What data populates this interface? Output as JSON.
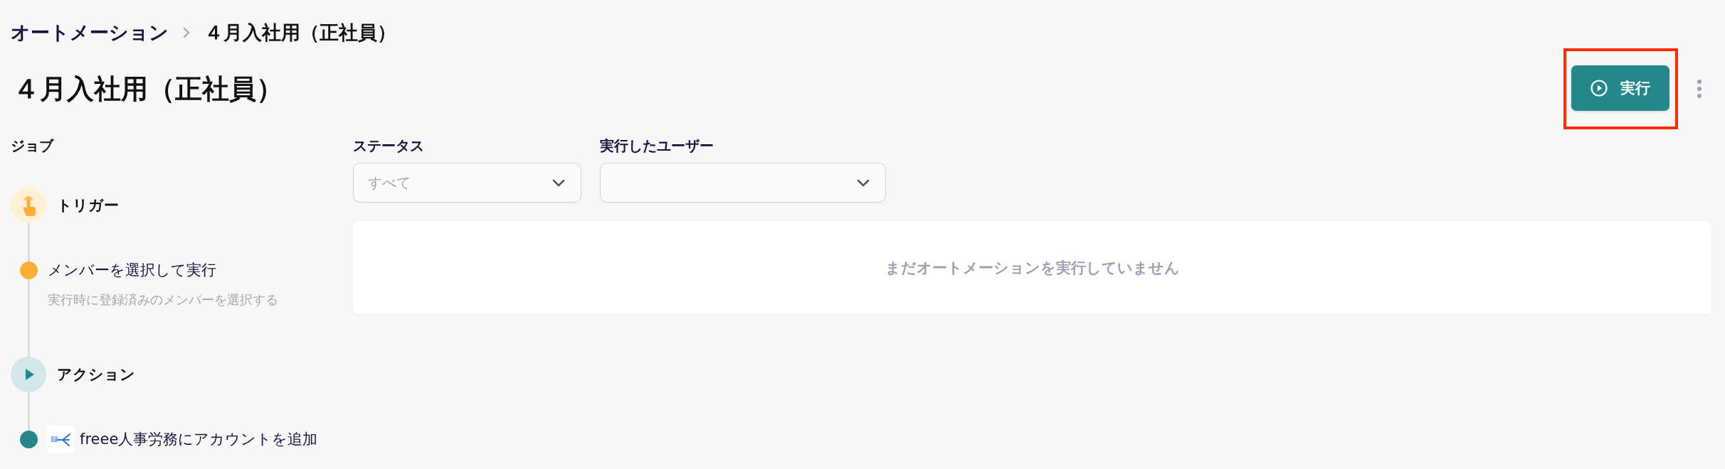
{
  "breadcrumb": [
    {
      "label": "オートメーション",
      "kind": "link"
    },
    {
      "label": "４月入社用（正社員）",
      "kind": "current"
    }
  ],
  "title": "４月入社用（正社員）",
  "run_button": {
    "label": "実行",
    "highlighted": true
  },
  "jobs": {
    "heading": "ジョブ",
    "sections": [
      {
        "kind": "trigger",
        "label": "トリガー",
        "steps": [
          {
            "label": "メンバーを選択して実行",
            "description": "実行時に登録済みのメンバーを選択する",
            "color": "#ffad33"
          }
        ]
      },
      {
        "kind": "action",
        "label": "アクション",
        "steps": [
          {
            "label": "freee人事労務にアカウントを追加",
            "color": "#24878a",
            "app_icon": true
          }
        ]
      }
    ]
  },
  "filters": [
    {
      "label": "ステータス",
      "placeholder": "すべて"
    },
    {
      "label": "実行したユーザー"
    }
  ],
  "empty_message": "まだオートメーションを実行していません"
}
